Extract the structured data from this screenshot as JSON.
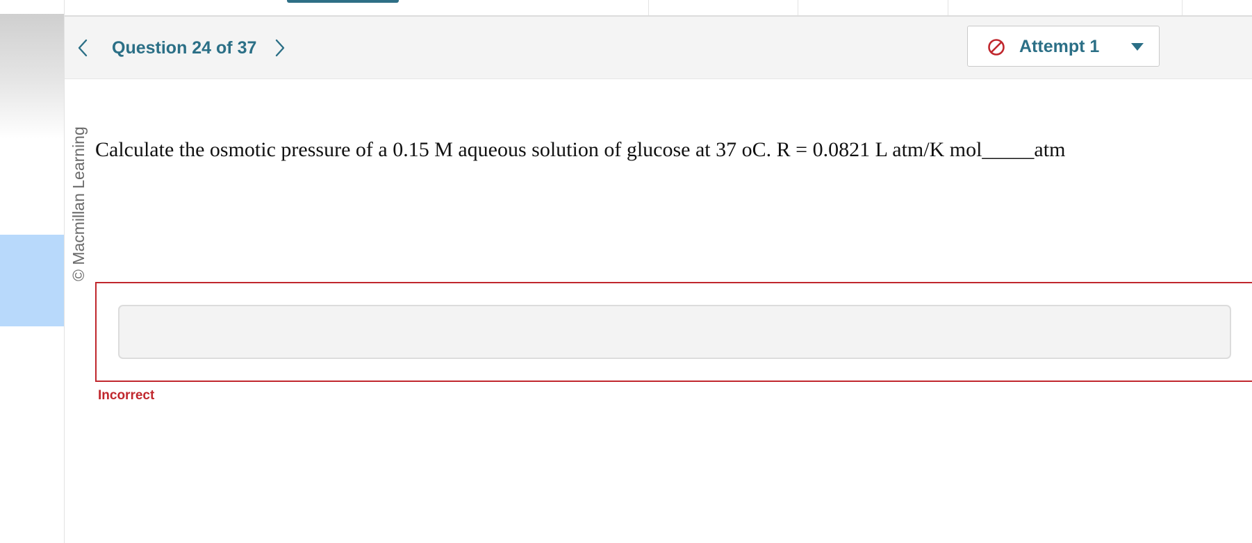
{
  "header": {
    "question_label": "Question 24 of 37",
    "attempt_label": "Attempt 1"
  },
  "sidebar": {
    "copyright": "© Macmillan Learning"
  },
  "question": {
    "text": "Calculate the osmotic pressure of a 0.15 M aqueous solution of glucose at 37 oC. R = 0.0821 L atm/K mol_____atm"
  },
  "answer": {
    "value": "",
    "placeholder": ""
  },
  "feedback": {
    "status": "Incorrect"
  },
  "colors": {
    "accent": "#2b6f86",
    "error": "#c0272d",
    "header_bg": "#f4f4f4",
    "highlight": "#b8d9fb"
  },
  "icons": {
    "prev": "chevron-left-icon",
    "next": "chevron-right-icon",
    "attempt_status": "no-entry-icon",
    "dropdown": "caret-down-icon"
  }
}
